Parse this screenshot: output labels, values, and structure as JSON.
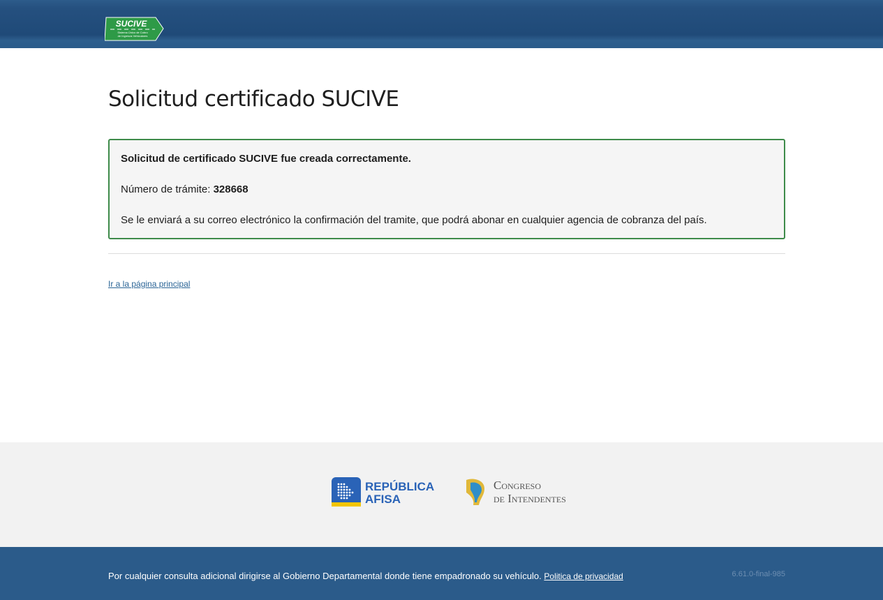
{
  "header": {
    "logo_text": "SUCIVE",
    "logo_subtext_line1": "Sistema Único de Cobro",
    "logo_subtext_line2": "de Ingresos Vehiculares"
  },
  "page": {
    "title": "Solicitud certificado SUCIVE"
  },
  "alert": {
    "success_message": "Solicitud de certificado SUCIVE fue creada correctamente.",
    "tramite_label": "Número de trámite:",
    "tramite_number": "328668",
    "info_message": "Se le enviará a su correo electrónico la confirmación del tramite, que podrá abonar en cualquier agencia de cobranza del país.",
    "border_color": "#3e8b4a"
  },
  "links": {
    "home": "Ir a la página principal"
  },
  "partners": {
    "afisa_line1": "REPÚBLICA",
    "afisa_line2": "AFISA",
    "congreso_line1": "Congreso",
    "congreso_line2": "de Intendentes"
  },
  "footer": {
    "text": "Por cualquier consulta adicional dirigirse al Gobierno Departamental donde tiene empadronado su vehículo.",
    "privacy_link": "Politica de privacidad",
    "version": "6.61.0-final-985"
  },
  "colors": {
    "header_bg": "#1f4a78",
    "footer_bg": "#2b5b8a",
    "link": "#2a6496"
  }
}
